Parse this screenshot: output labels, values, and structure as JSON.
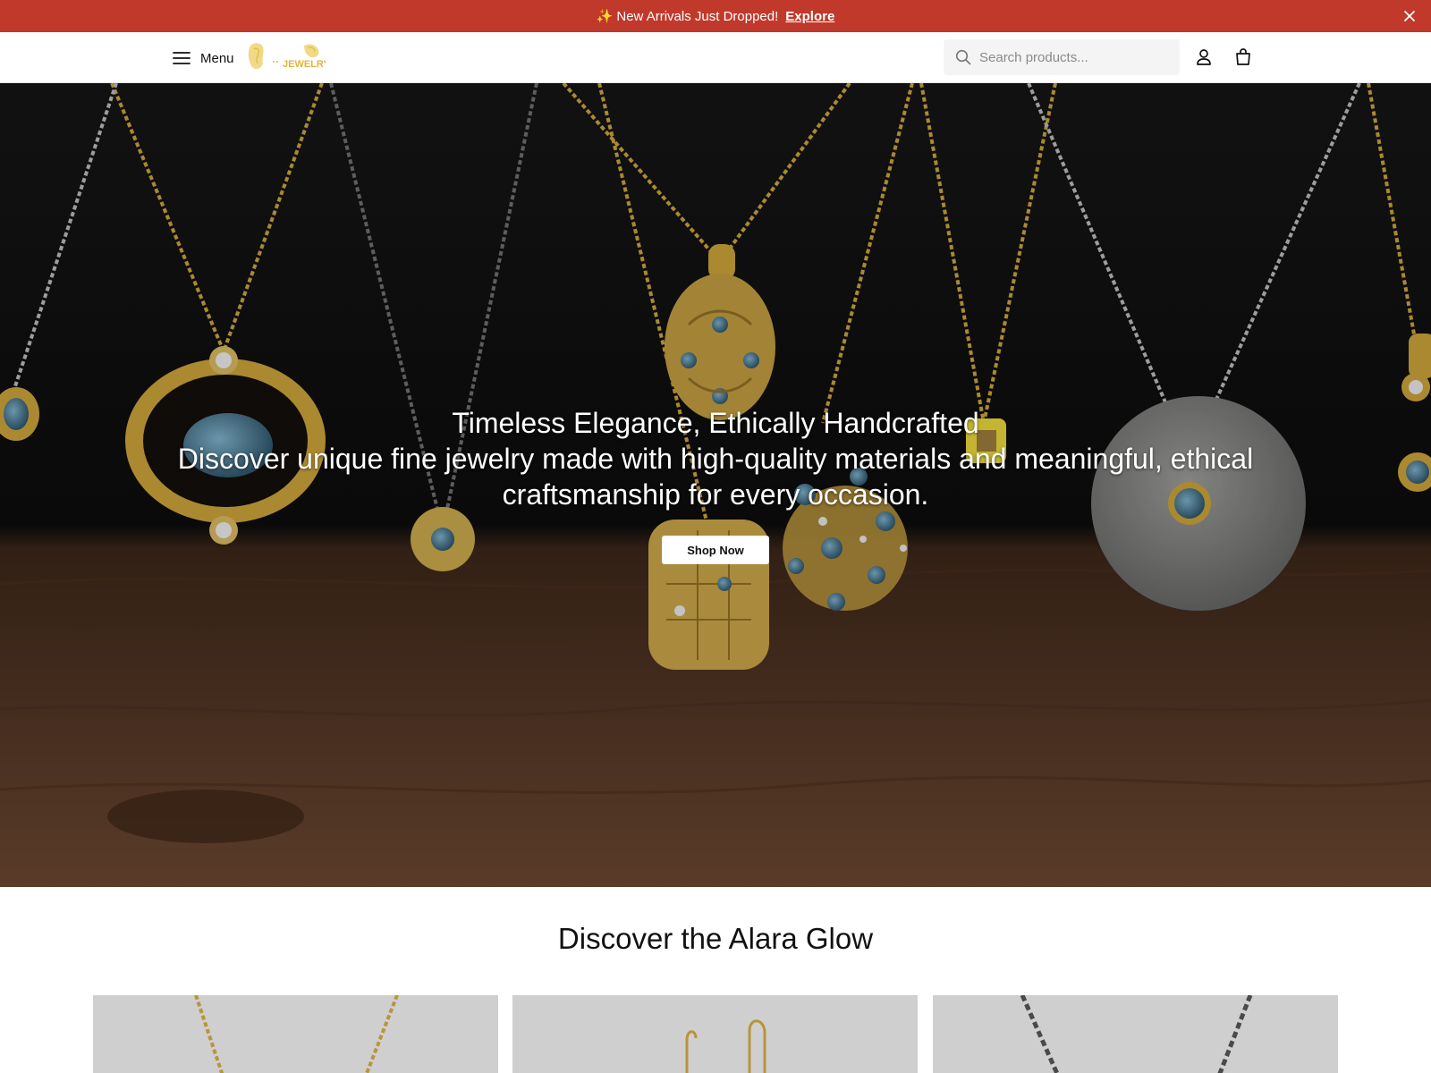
{
  "announcement": {
    "sparkle": "✨",
    "message": "New Arrivals Just Dropped!",
    "link": "Explore"
  },
  "header": {
    "menu_label": "Menu",
    "logo_text": "JEWELRY",
    "search_placeholder": "Search products..."
  },
  "hero": {
    "title": "Timeless Elegance, Ethically Handcrafted",
    "subtitle": "Discover unique fine jewelry made with high-quality materials and meaningful, ethical craftsmanship for every occasion.",
    "cta": "Shop Now"
  },
  "section": {
    "title": "Discover the Alara Glow"
  },
  "colors": {
    "announcement_bg": "#c0392b",
    "gold": "#c9a13a",
    "silver": "#b9b9b9",
    "gem_blue": "#3e6b86",
    "wood": "#5a3a26"
  },
  "icons": [
    "menu-icon",
    "search-icon",
    "account-icon",
    "bag-icon",
    "close-icon"
  ]
}
